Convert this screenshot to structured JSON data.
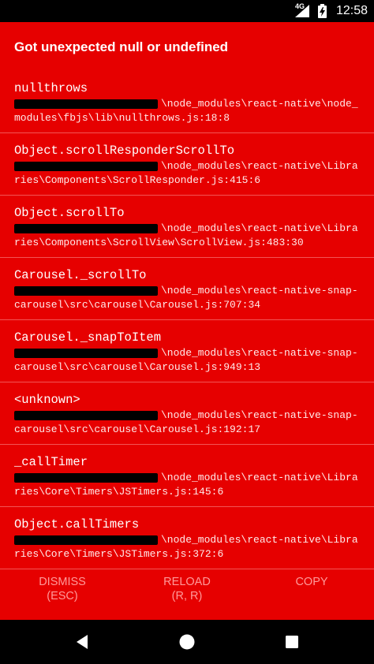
{
  "status_bar": {
    "network": "4G",
    "time": "12:58",
    "icons": [
      "signal-icon",
      "battery-charging-icon"
    ]
  },
  "error": {
    "title": "Got unexpected null or undefined",
    "frames": [
      {
        "fn": "nullthrows",
        "path": "\\node_modules\\react-native\\node_modules\\fbjs\\lib\\nullthrows.js:18:8"
      },
      {
        "fn": "Object.scrollResponderScrollTo",
        "path": "\\node_modules\\react-native\\Libraries\\Components\\ScrollResponder.js:415:6"
      },
      {
        "fn": "Object.scrollTo",
        "path": "\\node_modules\\react-native\\Libraries\\Components\\ScrollView\\ScrollView.js:483:30"
      },
      {
        "fn": "Carousel._scrollTo",
        "path": "\\node_modules\\react-native-snap-carousel\\src\\carousel\\Carousel.js:707:34"
      },
      {
        "fn": "Carousel._snapToItem",
        "path": "\\node_modules\\react-native-snap-carousel\\src\\carousel\\Carousel.js:949:13"
      },
      {
        "fn": "<unknown>",
        "path": "\\node_modules\\react-native-snap-carousel\\src\\carousel\\Carousel.js:192:17"
      },
      {
        "fn": "_callTimer",
        "path": "\\node_modules\\react-native\\Libraries\\Core\\Timers\\JSTimers.js:145:6"
      },
      {
        "fn": "Object.callTimers",
        "path": "\\node_modules\\react-native\\Libraries\\Core\\Timers\\JSTimers.js:372:6"
      }
    ]
  },
  "buttons": {
    "dismiss": {
      "line1": "DISMISS",
      "line2": "(ESC)"
    },
    "reload": {
      "line1": "RELOAD",
      "line2": "(R, R)"
    },
    "copy": {
      "line1": "COPY"
    }
  },
  "navbar": {
    "icons": [
      "back-icon",
      "home-icon",
      "recents-icon"
    ]
  },
  "colors": {
    "background": "#e60000",
    "button_text": "#ff9a9a",
    "redaction": "#000000"
  }
}
